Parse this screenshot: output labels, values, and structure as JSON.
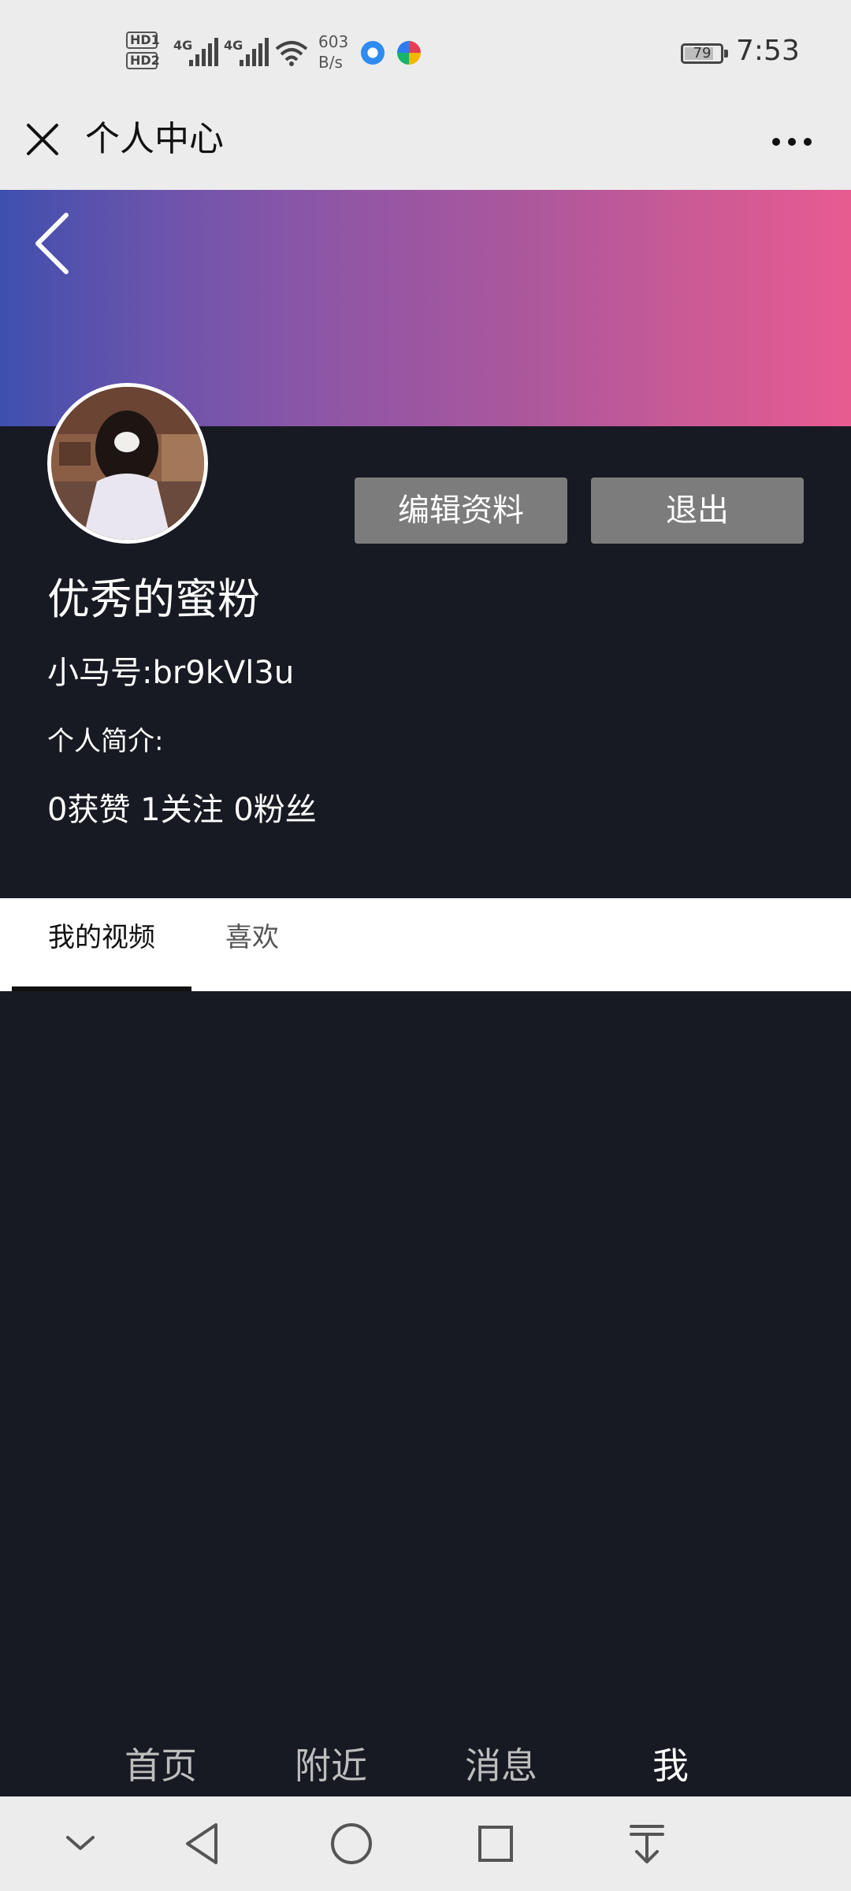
{
  "status_bar": {
    "hd1": "HD1",
    "hd2": "HD2",
    "network1": "4G",
    "network2": "4G",
    "speed_value": "603",
    "speed_unit": "B/s",
    "battery": "79",
    "time": "7:53"
  },
  "title_bar": {
    "title": "个人中心"
  },
  "profile": {
    "edit_button": "编辑资料",
    "logout_button": "退出",
    "name": "优秀的蜜粉",
    "account": "小马号:br9kVl3u",
    "bio": "个人简介:",
    "stats": "0获赞 1关注 0粉丝"
  },
  "tabs": [
    {
      "label": "我的视频",
      "active": true
    },
    {
      "label": "喜欢",
      "active": false
    }
  ],
  "bottom_nav": [
    {
      "label": "首页",
      "active": false
    },
    {
      "label": "附近",
      "active": false
    },
    {
      "label": "消息",
      "active": false
    },
    {
      "label": "我",
      "active": true
    }
  ],
  "colors": {
    "page_bg": "#171923",
    "banner_start": "#3f4fae",
    "banner_end": "#e85b91",
    "button_bg": "#7c7c7c"
  }
}
